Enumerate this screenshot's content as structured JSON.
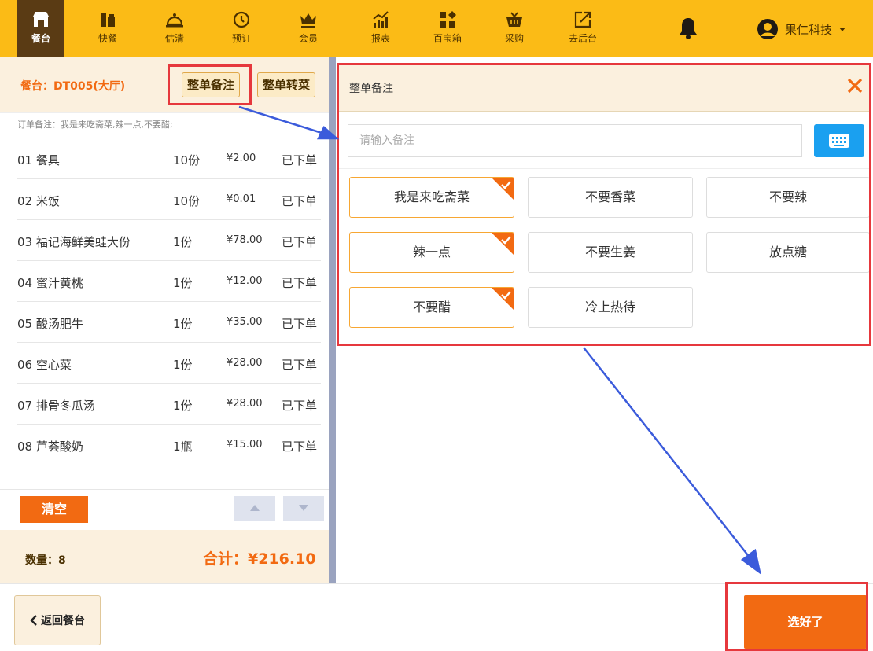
{
  "nav": {
    "items": [
      {
        "label": "餐台",
        "icon": "shop-icon",
        "active": true
      },
      {
        "label": "快餐",
        "icon": "fast-food-icon",
        "active": false
      },
      {
        "label": "估清",
        "icon": "cloche-icon",
        "active": false
      },
      {
        "label": "预订",
        "icon": "clock-icon",
        "active": false
      },
      {
        "label": "会员",
        "icon": "crown-icon",
        "active": false
      },
      {
        "label": "报表",
        "icon": "chart-icon",
        "active": false
      },
      {
        "label": "百宝箱",
        "icon": "apps-icon",
        "active": false
      },
      {
        "label": "采购",
        "icon": "basket-icon",
        "active": false
      },
      {
        "label": "去后台",
        "icon": "external-link-icon",
        "active": false
      }
    ],
    "bell_icon": "bell-icon",
    "user_name": "果仁科技",
    "user_icon": "user-avatar-icon",
    "dropdown_icon": "caret-down-icon"
  },
  "order": {
    "table_label": "餐台：DT005(大厅)",
    "btn_order_note": "整单备注",
    "btn_transfer": "整单转菜",
    "order_note": "订单备注：我是来吃斋菜,辣一点,不要醋;",
    "items": [
      {
        "name": "01 餐具",
        "qty": "10份",
        "price": "¥2.00",
        "status": "已下单"
      },
      {
        "name": "02 米饭",
        "qty": "10份",
        "price": "¥0.01",
        "status": "已下单"
      },
      {
        "name": "03 福记海鲜美蛙大份",
        "qty": "1份",
        "price": "¥78.00",
        "status": "已下单"
      },
      {
        "name": "04 蜜汁黄桃",
        "qty": "1份",
        "price": "¥12.00",
        "status": "已下单"
      },
      {
        "name": "05 酸汤肥牛",
        "qty": "1份",
        "price": "¥35.00",
        "status": "已下单"
      },
      {
        "name": "06 空心菜",
        "qty": "1份",
        "price": "¥28.00",
        "status": "已下单"
      },
      {
        "name": "07 排骨冬瓜汤",
        "qty": "1份",
        "price": "¥28.00",
        "status": "已下单"
      },
      {
        "name": "08 芦荟酸奶",
        "qty": "1瓶",
        "price": "¥15.00",
        "status": "已下单"
      }
    ],
    "btn_clear": "清空",
    "quantity_label": "数量：8",
    "total_label": "合计：¥216.10"
  },
  "remark_panel": {
    "title": "整单备注",
    "close_icon": "close-icon",
    "input_placeholder": "请输入备注",
    "keyboard_icon": "keyboard-icon",
    "tags": [
      {
        "label": "我是来吃斋菜",
        "selected": true
      },
      {
        "label": "不要香菜",
        "selected": false
      },
      {
        "label": "不要辣",
        "selected": false
      },
      {
        "label": "辣一点",
        "selected": true
      },
      {
        "label": "不要生姜",
        "selected": false
      },
      {
        "label": "放点糖",
        "selected": false
      },
      {
        "label": "不要醋",
        "selected": true
      },
      {
        "label": "冷上热待",
        "selected": false
      }
    ]
  },
  "footer": {
    "btn_back": "返回餐台",
    "btn_done": "选好了"
  },
  "colors": {
    "nav_bg": "#fbbb16",
    "nav_active": "#5a3b14",
    "accent_orange": "#f26a12",
    "panel_cream": "#fbf0de",
    "keyboard_blue": "#1aa0f0",
    "annotation_red": "#e6383d",
    "annotation_arrow": "#3b5bdb"
  }
}
